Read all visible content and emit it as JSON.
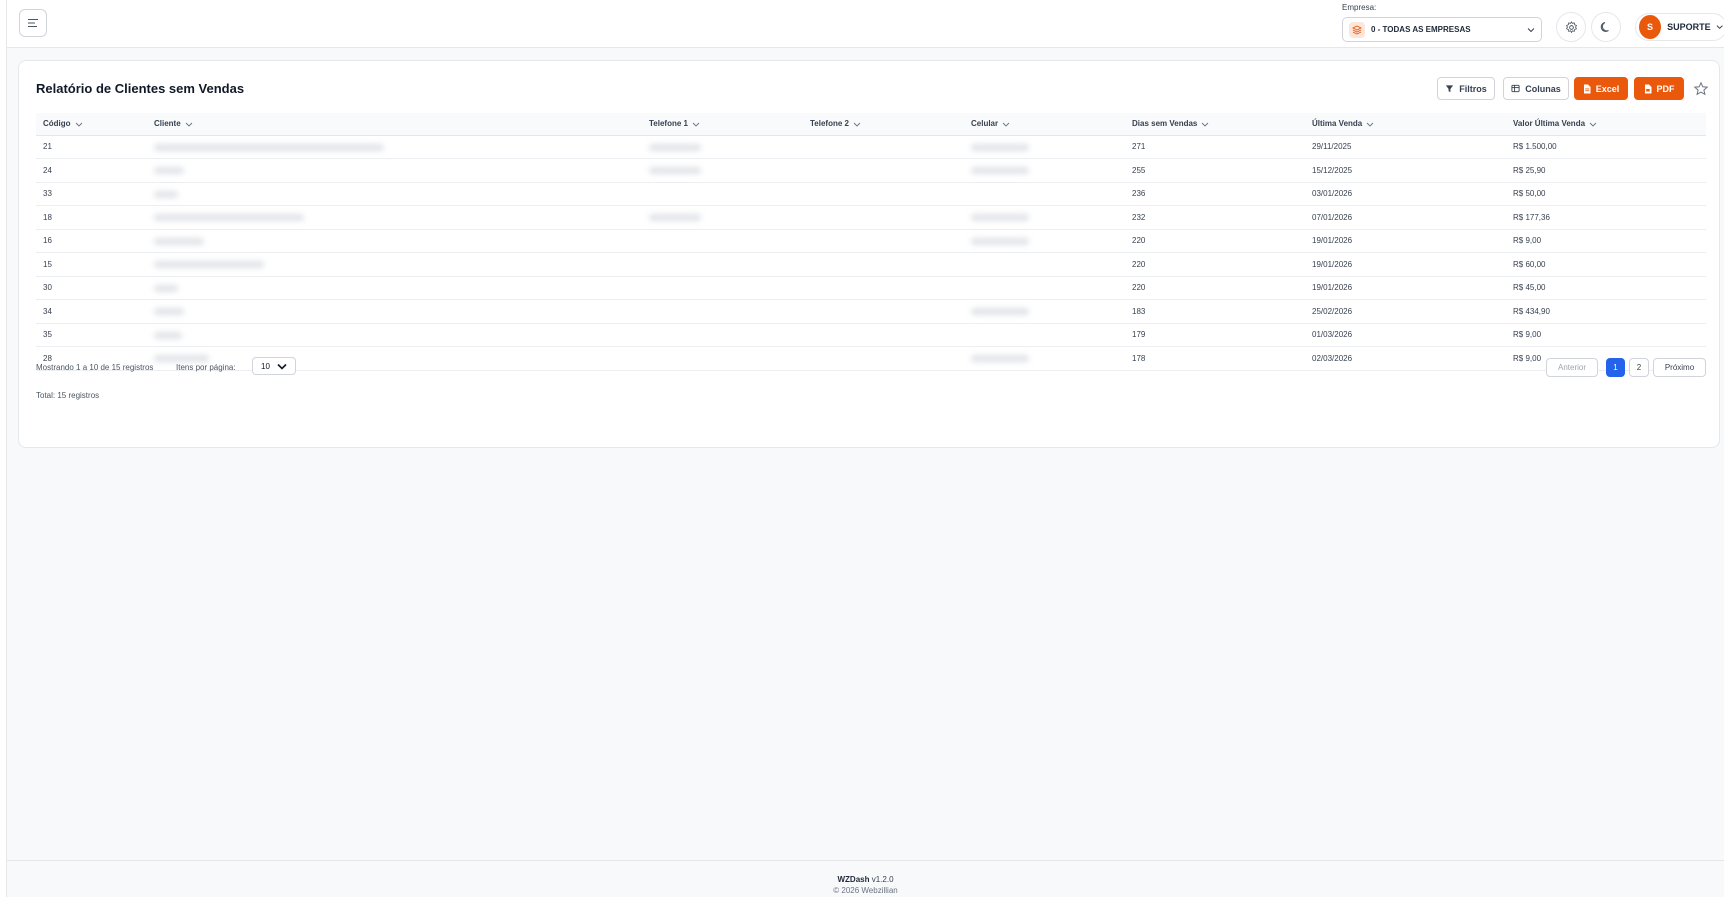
{
  "header": {
    "empresa_label": "Empresa:",
    "empresa_value": "0 - TODAS AS EMPRESAS",
    "user_initial": "S",
    "user_name": "SUPORTE"
  },
  "report": {
    "title": "Relatório de Clientes sem Vendas",
    "buttons": {
      "filters": "Filtros",
      "columns": "Colunas",
      "excel": "Excel",
      "pdf": "PDF"
    },
    "columns": [
      "Código",
      "Cliente",
      "Telefone 1",
      "Telefone 2",
      "Celular",
      "Dias sem Vendas",
      "Última Venda",
      "Valor Última Venda"
    ],
    "rows": [
      {
        "codigo": "21",
        "dias": "271",
        "ultima": "29/11/2025",
        "valor": "R$ 1.500,00"
      },
      {
        "codigo": "24",
        "dias": "255",
        "ultima": "15/12/2025",
        "valor": "R$ 25,90"
      },
      {
        "codigo": "33",
        "dias": "236",
        "ultima": "03/01/2026",
        "valor": "R$ 50,00"
      },
      {
        "codigo": "18",
        "dias": "232",
        "ultima": "07/01/2026",
        "valor": "R$ 177,36"
      },
      {
        "codigo": "16",
        "dias": "220",
        "ultima": "19/01/2026",
        "valor": "R$ 9,00"
      },
      {
        "codigo": "15",
        "dias": "220",
        "ultima": "19/01/2026",
        "valor": "R$ 60,00"
      },
      {
        "codigo": "30",
        "dias": "220",
        "ultima": "19/01/2026",
        "valor": "R$ 45,00"
      },
      {
        "codigo": "34",
        "dias": "183",
        "ultima": "25/02/2026",
        "valor": "R$ 434,90"
      },
      {
        "codigo": "35",
        "dias": "179",
        "ultima": "01/03/2026",
        "valor": "R$ 9,00"
      },
      {
        "codigo": "28",
        "dias": "178",
        "ultima": "02/03/2026",
        "valor": "R$ 9,00"
      }
    ]
  },
  "pagination": {
    "showing": "Mostrando 1 a 10 de 15 registros",
    "per_page_label": "Itens por página:",
    "per_page_value": "10",
    "total": "Total: 15 registros",
    "prev": "Anterior",
    "pages": [
      "1",
      "2"
    ],
    "next": "Próximo"
  },
  "footer": {
    "brand": "WZDash",
    "version": "v1.2.0",
    "copyright": "© 2026 Webzillian"
  },
  "colors": {
    "accent": "#ea580c",
    "active_page": "#2563eb"
  }
}
